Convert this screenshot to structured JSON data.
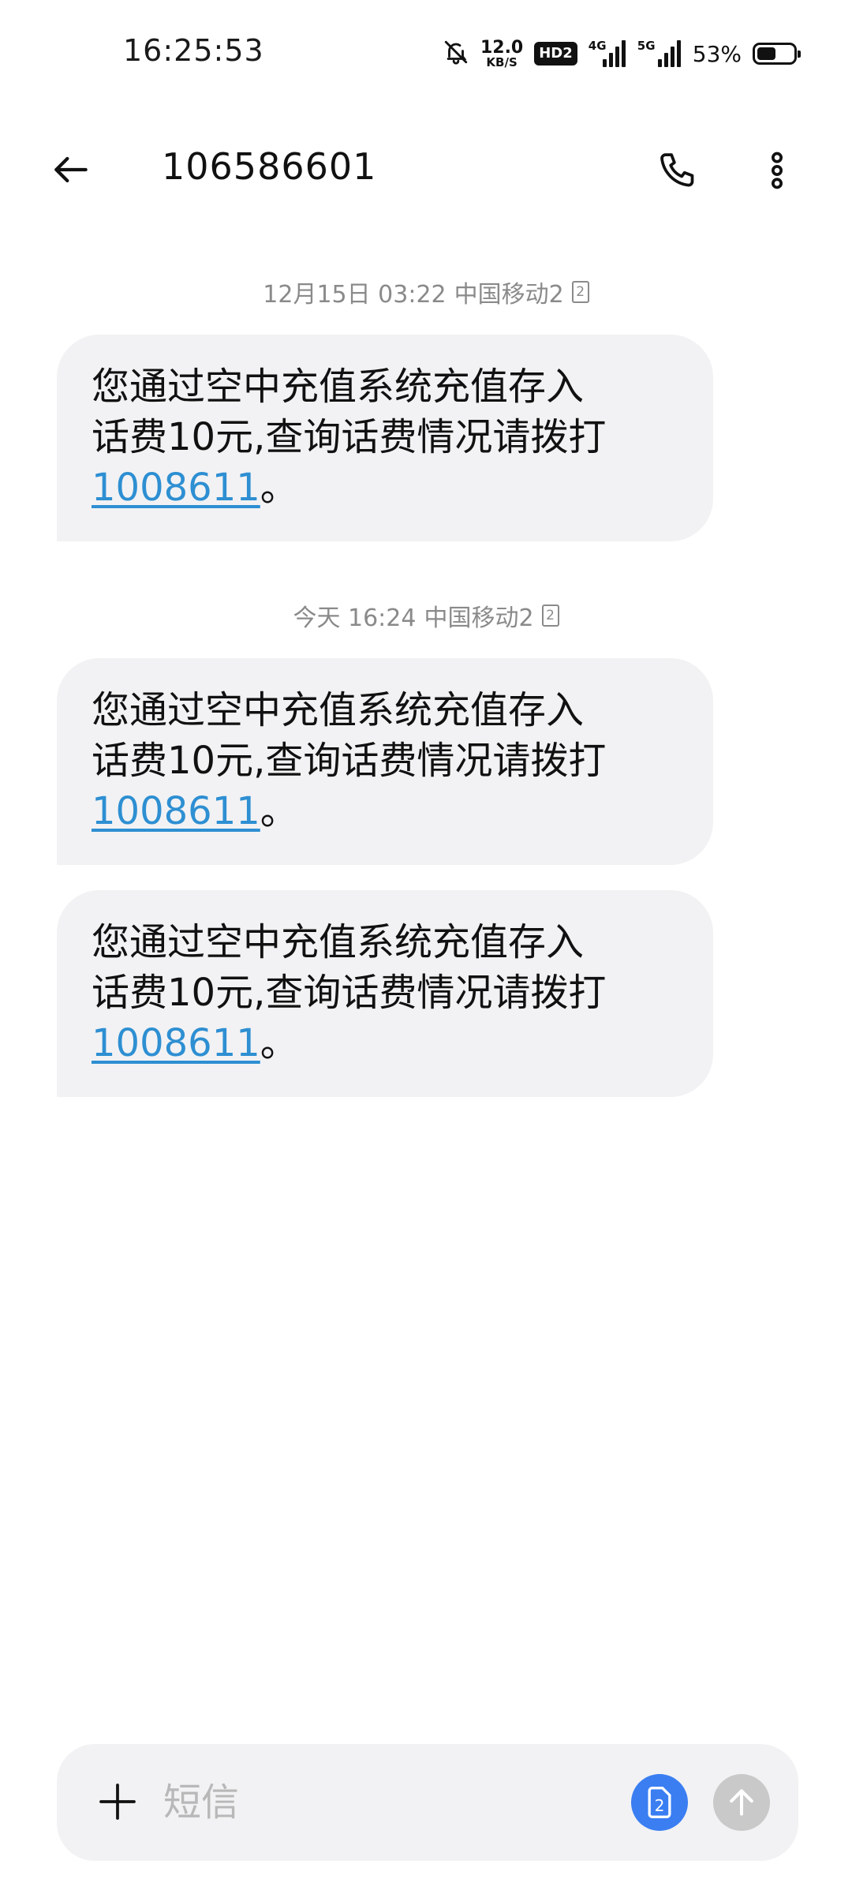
{
  "status_bar": {
    "time": "16:25:53",
    "net_speed_value": "12.0",
    "net_speed_unit": "KB/S",
    "hd_label": "HD2",
    "sig1_label": "4G",
    "sig2_label": "5G",
    "battery_pct": "53%",
    "battery_level": 0.53,
    "icons": [
      "bell-off-icon",
      "hd-icon",
      "signal-icon",
      "signal-icon",
      "battery-icon"
    ]
  },
  "app_bar": {
    "title": "106586601",
    "icons": [
      "back-arrow-icon",
      "phone-icon",
      "more-vert-icon"
    ]
  },
  "messages": [
    {
      "meta_time": "12月15日 03:22",
      "meta_carrier": "中国移动2",
      "sim": "2",
      "line1": "您通过空中充值系统充值存入",
      "line2": "话费10元,查询话费情况请拨打",
      "link": "1008611",
      "suffix": "。"
    },
    {
      "meta_time": "今天 16:24",
      "meta_carrier": "中国移动2",
      "sim": "2",
      "line1": "您通过空中充值系统充值存入",
      "line2": "话费10元,查询话费情况请拨打",
      "link": "1008611",
      "suffix": "。"
    },
    {
      "line1": "您通过空中充值系统充值存入",
      "line2": "话费10元,查询话费情况请拨打",
      "link": "1008611",
      "suffix": "。"
    }
  ],
  "compose": {
    "placeholder": "短信",
    "sim_label": "2",
    "icons": [
      "plus-icon",
      "sim-card-icon",
      "send-arrow-icon"
    ]
  },
  "colors": {
    "link": "#2e8fd2",
    "bubble": "#f2f2f4",
    "sim_button": "#3a7ef2",
    "send_disabled": "#c9c9c9"
  }
}
